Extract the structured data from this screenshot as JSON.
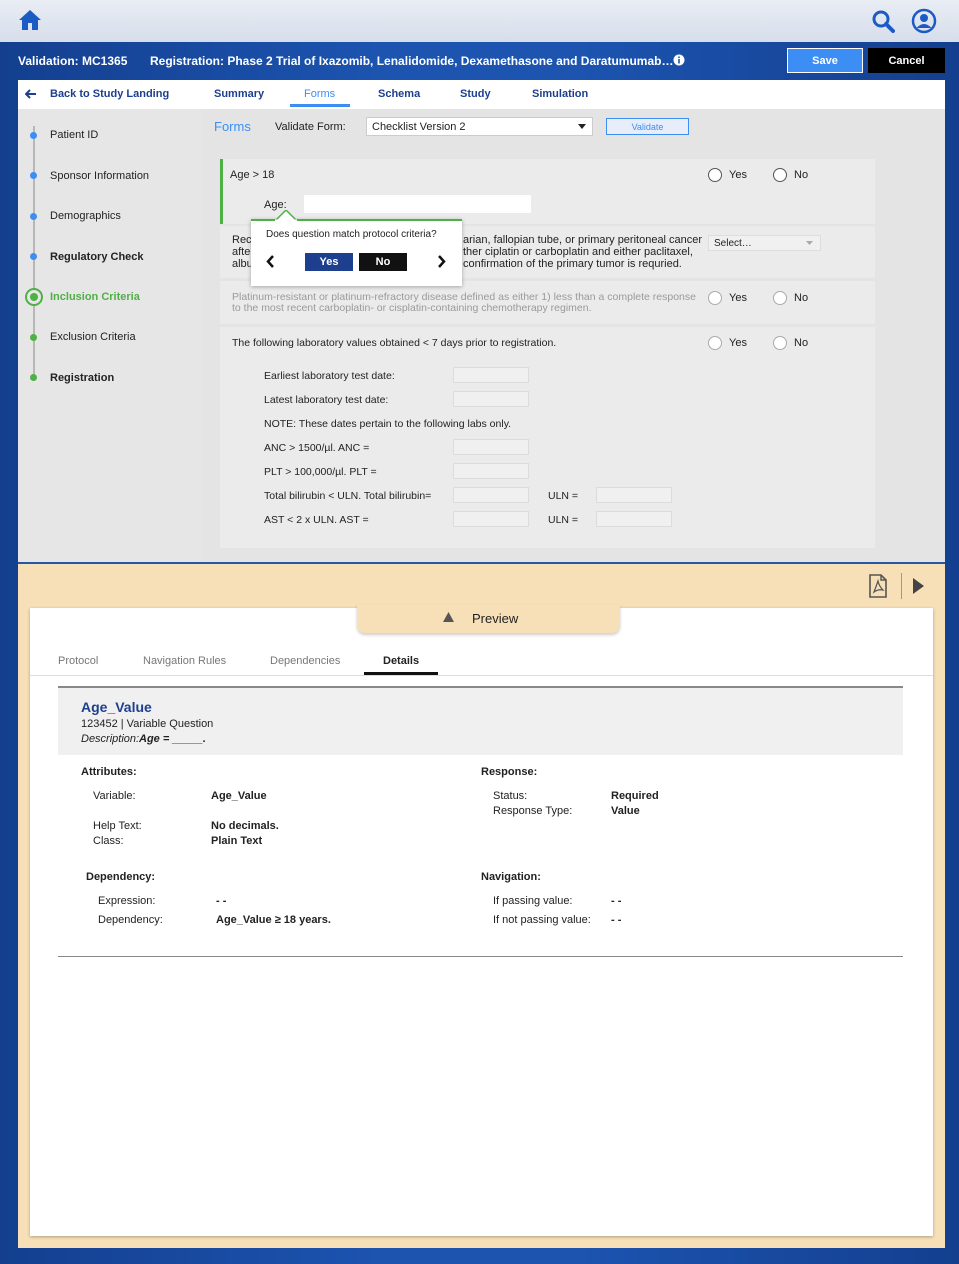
{
  "header": {
    "validation": "Validation: MC1365",
    "registration": "Registration: Phase 2 Trial of Ixazomib, Lenalidomide, Dexamethasone and Daratumumab…",
    "save_label": "Save",
    "cancel_label": "Cancel"
  },
  "nav": {
    "back_label": "Back to Study Landing",
    "tabs": [
      "Summary",
      "Forms",
      "Schema",
      "Study",
      "Simulation"
    ],
    "active_tab": "Forms"
  },
  "sidebar": {
    "items": [
      "Patient ID",
      "Sponsor Information",
      "Demographics",
      "Regulatory Check",
      "Inclusion Criteria",
      "Exclusion Criteria",
      "Registration"
    ]
  },
  "form": {
    "title": "Forms",
    "validate_form_label": "Validate Form:",
    "select_value": "Checklist Version 2",
    "validate_button": "Validate",
    "q1": {
      "label": "Age > 18",
      "yes": "Yes",
      "no": "No",
      "age_label": "Age:"
    },
    "q2": {
      "text_line1_left": "Rec",
      "text_line1_right": "arian, fallopian tube, or primary peritoneal cancer",
      "text_line2_left": "after",
      "text_line2_right": "ther ciplatin or carboplatin and either paclitaxel,",
      "text_line3_left": "albu",
      "text_line3_right": "confirmation of the primary tumor is requried.",
      "select_placeholder": "Select…"
    },
    "q3": {
      "text": "Platinum-resistant or platinum-refractory disease defined as either 1) less than a complete response to the most recent carboplatin- or cisplatin-containing chemotherapy regimen.",
      "yes": "Yes",
      "no": "No"
    },
    "q4": {
      "text": "The following laboratory values obtained < 7 days prior to registration.",
      "yes": "Yes",
      "no": "No",
      "earliest": "Earliest laboratory test date:",
      "latest": "Latest laboratory test date:",
      "note": "NOTE: These dates pertain to the following labs only.",
      "anc": "ANC > 1500/µl.   ANC =",
      "plt": "PLT > 100,000/µl.  PLT =",
      "bili": "Total bilirubin < ULN.  Total bilirubin=",
      "ast": "AST < 2 x ULN. AST =",
      "uln": "ULN ="
    }
  },
  "popup": {
    "question": "Does question match protocol criteria?",
    "yes": "Yes",
    "no": "No"
  },
  "preview": {
    "label": "Preview",
    "tabs": [
      "Protocol",
      "Navigation Rules",
      "Dependencies",
      "Details"
    ],
    "active_tab": "Details",
    "var_name": "Age_Value",
    "var_meta": "123452 | Variable Question",
    "desc_label": "Description:",
    "desc_value": "Age = _____.",
    "attributes_title": "Attributes:",
    "variable_label": "Variable:",
    "variable_value": "Age_Value",
    "help_label": "Help Text:",
    "help_value": "No decimals.",
    "class_label": "Class:",
    "class_value": "Plain Text",
    "response_title": "Response:",
    "status_label": "Status:",
    "status_value": "Required",
    "rtype_label": "Response Type:",
    "rtype_value": "Value",
    "dependency_title": "Dependency:",
    "expression_label": "Expression:",
    "expression_value": "- -",
    "dependency_label": "Dependency:",
    "dependency_value": "Age_Value ≥ 18 years.",
    "navigation_title": "Navigation:",
    "passing_label": "If passing value:",
    "passing_value": "- -",
    "notpassing_label": "If not passing value:",
    "notpassing_value": "- -"
  },
  "colors": {
    "accent": "#1d3f8e",
    "brand_blue": "#1c54b0",
    "save_blue": "#3d8ef4",
    "green": "#4fb046",
    "drawer": "#f7e0b7"
  }
}
